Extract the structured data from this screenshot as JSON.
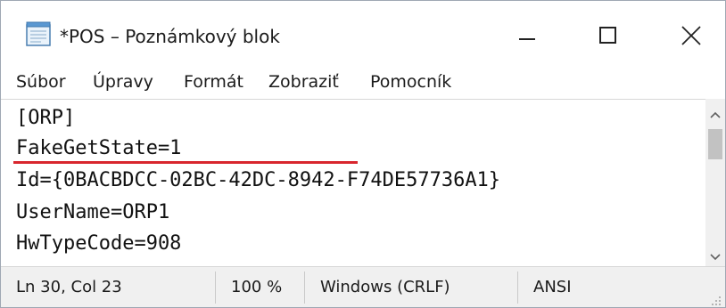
{
  "window": {
    "title": "*POS – Poznámkový blok",
    "icon": "notepad-icon",
    "buttons": {
      "minimize": "minimize-icon",
      "maximize": "maximize-icon",
      "close": "close-icon"
    }
  },
  "menu": {
    "items": [
      {
        "label": "Súbor"
      },
      {
        "label": "Úpravy"
      },
      {
        "label": "Formát"
      },
      {
        "label": "Zobraziť"
      },
      {
        "label": "Pomocník"
      }
    ]
  },
  "editor": {
    "lines": [
      "[ORP]",
      "FakeGetState=1",
      "Id={0BACBDCC-02BC-42DC-8942-F74DE57736A1}",
      "UserName=ORP1",
      "HwTypeCode=908",
      ""
    ],
    "highlight_color": "#d8262d"
  },
  "status": {
    "position": "Ln 30, Col 23",
    "zoom": "100 %",
    "line_ending": "Windows (CRLF)",
    "encoding": "ANSI"
  }
}
